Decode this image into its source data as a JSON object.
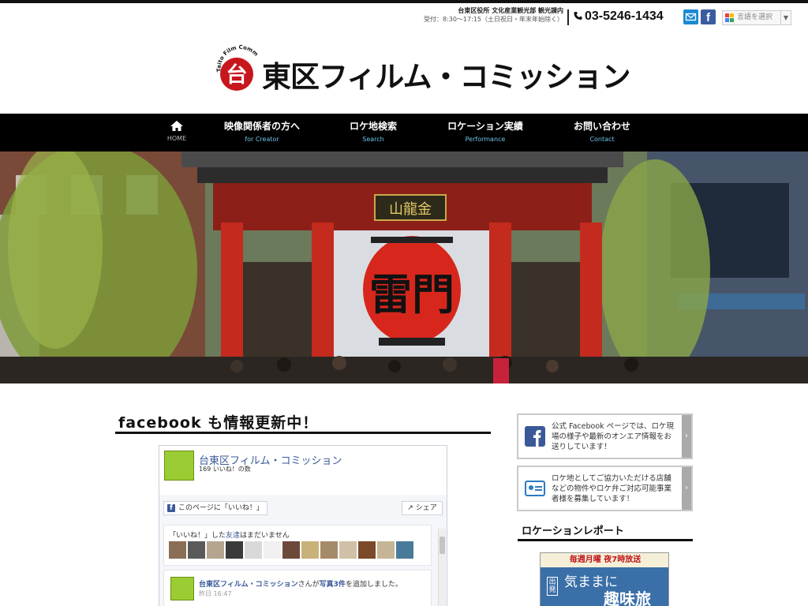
{
  "office": {
    "name": "台東区役所 文化産業観光部 観光課内",
    "hours": "受付：8:30〜17:15（土日祝日・年末年始除く）"
  },
  "phone": "03-5246-1434",
  "language_select": "言語を選択",
  "logo": {
    "title": "東区フィルム・コミッション",
    "seal_char": "台",
    "arc_text": "Taito Film Commission"
  },
  "nav": [
    {
      "jp": "",
      "en": "HOME"
    },
    {
      "jp": "映像関係者の方へ",
      "en": "for Creator"
    },
    {
      "jp": "ロケ地検索",
      "en": "Search"
    },
    {
      "jp": "ロケーション実績",
      "en": "Performance"
    },
    {
      "jp": "お問い合わせ",
      "en": "Contact"
    }
  ],
  "hero": {
    "gate_sign": "山龍金",
    "lantern_text": "雷門"
  },
  "main": {
    "section_title": "facebook も情報更新中！"
  },
  "facebook": {
    "page_name": "台東区フィルム・コミッション",
    "likes": "169 いいね！の数",
    "like_button": "このページに「いいね！」",
    "share_button": "シェア",
    "friends_text_a": "「いいね！」した",
    "friends_text_link": "友達",
    "friends_text_b": "はまだいません",
    "post_author": "台東区フィルム・コミッション",
    "post_mid": "さんが",
    "post_link": "写真3件",
    "post_end": "を追加しました。",
    "post_time": "昨日 16:47"
  },
  "sidebar": {
    "card1": "公式 Facebook ページでは、ロケ現場の様子や最新のオンエア情報をお送りしています！",
    "card2": "ロケ地としてご協力いただける店舗などの物件やロケ弁ご対応可能事業者様を募集しています！",
    "section_title": "ロケーションレポート",
    "banner_top": "毎週月曜 夜7時放送",
    "banner_tag": "出発",
    "banner_line1": "気ままに",
    "banner_line2": "趣味旅"
  },
  "colors": {
    "brand_red": "#c8161d",
    "nav_bg": "#000000",
    "nav_en": "#6fc3e8",
    "facebook_blue": "#3b5998"
  },
  "icons": [
    "phone-icon",
    "mail-icon",
    "facebook-icon",
    "google-translate-icon",
    "home-icon",
    "chevron-right-icon"
  ]
}
